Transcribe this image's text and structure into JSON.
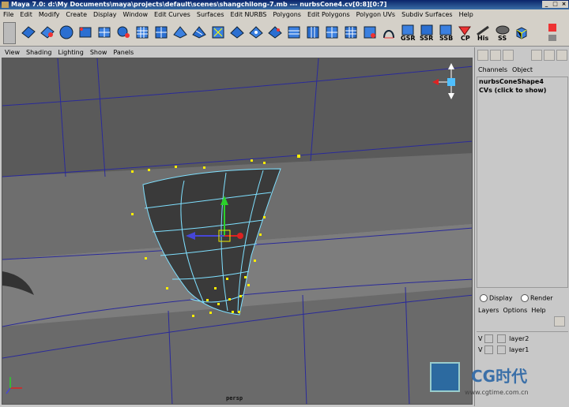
{
  "window": {
    "title": "Maya 7.0: d:\\My Documents\\maya\\projects\\default\\scenes\\shangchilong-7.mb  ---  nurbsCone4.cv[0:8][0:7]"
  },
  "menubar": [
    "File",
    "Edit",
    "Modify",
    "Create",
    "Display",
    "Window",
    "Edit Curves",
    "Surfaces",
    "Edit NURBS",
    "Polygons",
    "Edit Polygons",
    "Polygon UVs",
    "Subdiv Surfaces",
    "Help"
  ],
  "shelf": {
    "labels": [
      "GSR",
      "SSR",
      "SSB",
      "CP",
      "His",
      "SS"
    ]
  },
  "panel_menu": [
    "View",
    "Shading",
    "Lighting",
    "Show",
    "Panels"
  ],
  "viewport": {
    "camera_label": "persp"
  },
  "channel_box": {
    "tabs": [
      "Channels",
      "Object"
    ],
    "shape_name": "nurbsConeShape4",
    "cvs_label": "CVs (click to show)"
  },
  "layer_editor": {
    "display_label": "Display",
    "render_label": "Render",
    "menu": [
      "Layers",
      "Options",
      "Help"
    ],
    "layers": [
      {
        "visible": "V",
        "name": "layer2"
      },
      {
        "visible": "V",
        "name": "layer1"
      }
    ]
  },
  "watermark": {
    "logo": "CG时代",
    "url": "www.cgtime.com.cn"
  },
  "colors": {
    "grid_line": "#2a2a9a",
    "cv_point": "#ffee00",
    "wire": "#7fe0ff"
  }
}
